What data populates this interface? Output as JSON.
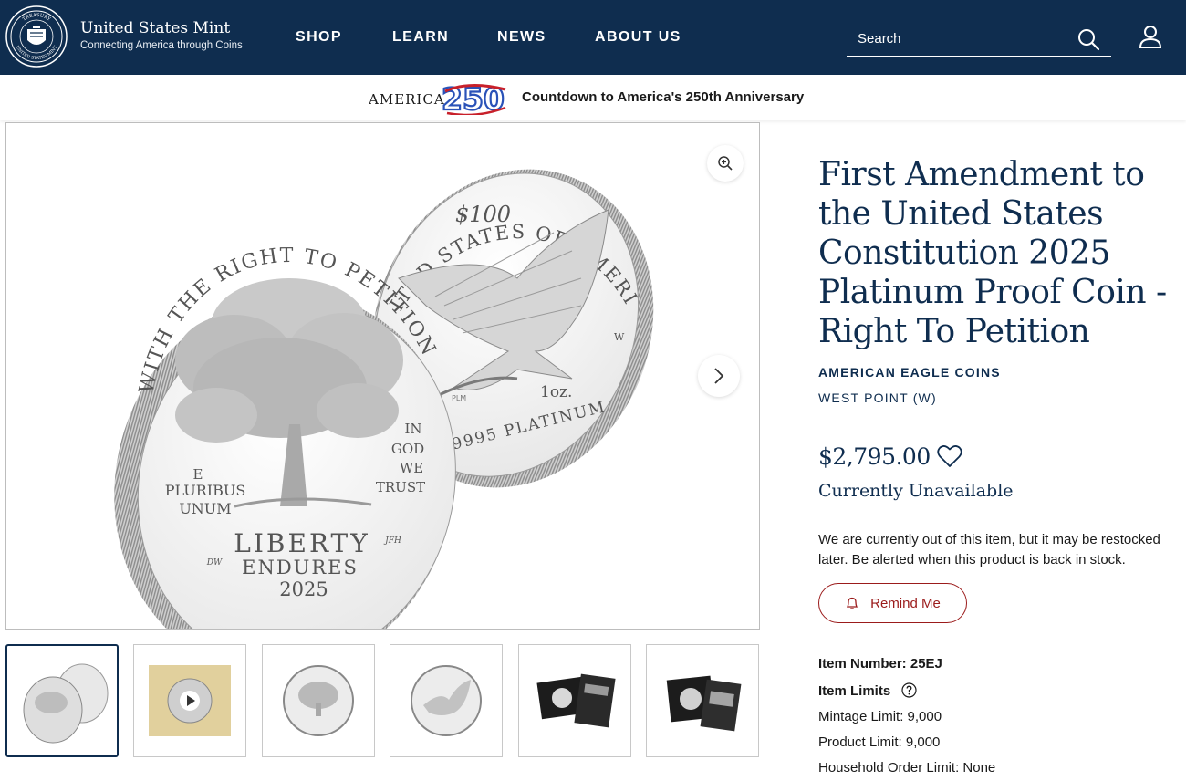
{
  "header": {
    "seal_text_top": "TREASURY",
    "seal_text_bottom": "UNITED STATES MINT",
    "brand_name": "United States Mint",
    "brand_tagline": "Connecting America through Coins",
    "nav": [
      "SHOP",
      "LEARN",
      "NEWS",
      "ABOUT US"
    ],
    "search_placeholder": "Search"
  },
  "banner": {
    "logo_word": "AMERICA",
    "logo_number": "250",
    "text": "Countdown to America's 250th Anniversary"
  },
  "gallery": {
    "obverse": {
      "legend": "WITH THE RIGHT TO PETITION",
      "motto_left": [
        "E",
        "PLURIBUS",
        "UNUM"
      ],
      "motto_right": [
        "IN",
        "GOD",
        "WE",
        "TRUST"
      ],
      "liberty": "LIBERTY",
      "endures": "ENDURES",
      "year": "2025",
      "initials_left": "DW",
      "initials_right": "JFH"
    },
    "reverse": {
      "legend": "UNITED STATES OF AMERICA",
      "denomination": "$100",
      "weight": "1oz.",
      "metal": ".9995 PLATINUM",
      "mint_mark": "W",
      "designer": "PLM"
    },
    "thumbnails": [
      "coin-pair",
      "video",
      "obverse",
      "reverse",
      "case-open",
      "case-closed"
    ]
  },
  "product": {
    "title": "First Amendment to the United States Constitution 2025 Platinum Proof Coin - Right To Petition",
    "category": "AMERICAN EAGLE COINS",
    "mint": "WEST POINT (W)",
    "price": "$2,795.00",
    "availability": "Currently Unavailable",
    "notice": "We are currently out of this item, but it may be restocked later. Be alerted when this product is back in stock.",
    "remind_label": "Remind Me",
    "item_number_label": "Item Number:",
    "item_number": "25EJ",
    "item_limits_label": "Item Limits",
    "mintage_limit": "Mintage Limit: 9,000",
    "product_limit": "Product Limit: 9,000",
    "household_limit": "Household Order Limit: None"
  },
  "colors": {
    "navy": "#0f2d4f",
    "accent_red": "#9b1b1b"
  }
}
